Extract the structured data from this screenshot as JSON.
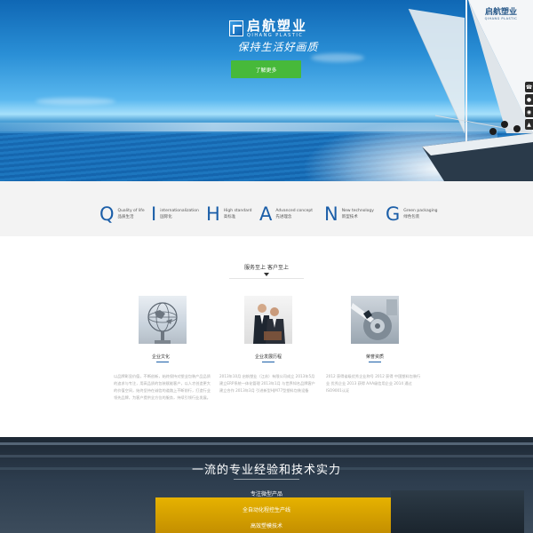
{
  "hero": {
    "logo_cn": "启航塑业",
    "logo_en": "QIHANG PLASTIC",
    "slogan": "保持生活好画质",
    "cta_label": "了解更多",
    "yacht_logo_cn": "启航塑业",
    "yacht_logo_en": "QIHANG PLASTIC"
  },
  "side_tools": [
    "phone",
    "qq",
    "wechat",
    "top"
  ],
  "features": [
    {
      "letter": "Q",
      "en": "Quality of life",
      "cn": "品质生活"
    },
    {
      "letter": "I",
      "en": "internationalization",
      "cn": "国际化"
    },
    {
      "letter": "H",
      "en": "High standard",
      "cn": "高标准"
    },
    {
      "letter": "A",
      "en": "Advanced concept",
      "cn": "先进理念"
    },
    {
      "letter": "N",
      "en": "New technology",
      "cn": "新型技术"
    },
    {
      "letter": "G",
      "en": "Green packaging",
      "cn": "绿色包装"
    }
  ],
  "service": {
    "title": "服务至上 客户至上",
    "columns": [
      {
        "caption": "企业文化",
        "desc": "以品牌彰显价值，不断创新，始终保持对塑业包装产品品质的追求与专注，用高品质的包装赋能客户，以人才创造更大的价值空间，始终坚持在诚信的道路上不断前行，打造行业领先品牌，为客户提供全方位的服务，持续引领行业发展。"
      },
      {
        "caption": "企业发展历程",
        "desc": "2013年10月 启航塑业（江苏）有限公司成立 2013年5月 建立ERP系统一体化管理 2013年1月 与世界知名品牌客户建立合作 2013年3月 引进新型HJM77型塑料包装设备"
      },
      {
        "caption": "荣誉资质",
        "desc": "2012 获得省级优秀企业称号 2012 获得 中国塑料包装行业 优秀企业 2013 获得 AAA级信用企业 2014 通过ISO9001认证"
      }
    ]
  },
  "banner": {
    "title": "一流的专业经验和技术实力",
    "items": [
      "专注微型产品",
      "全自动化程控生产线",
      "高效塑模技术"
    ]
  }
}
